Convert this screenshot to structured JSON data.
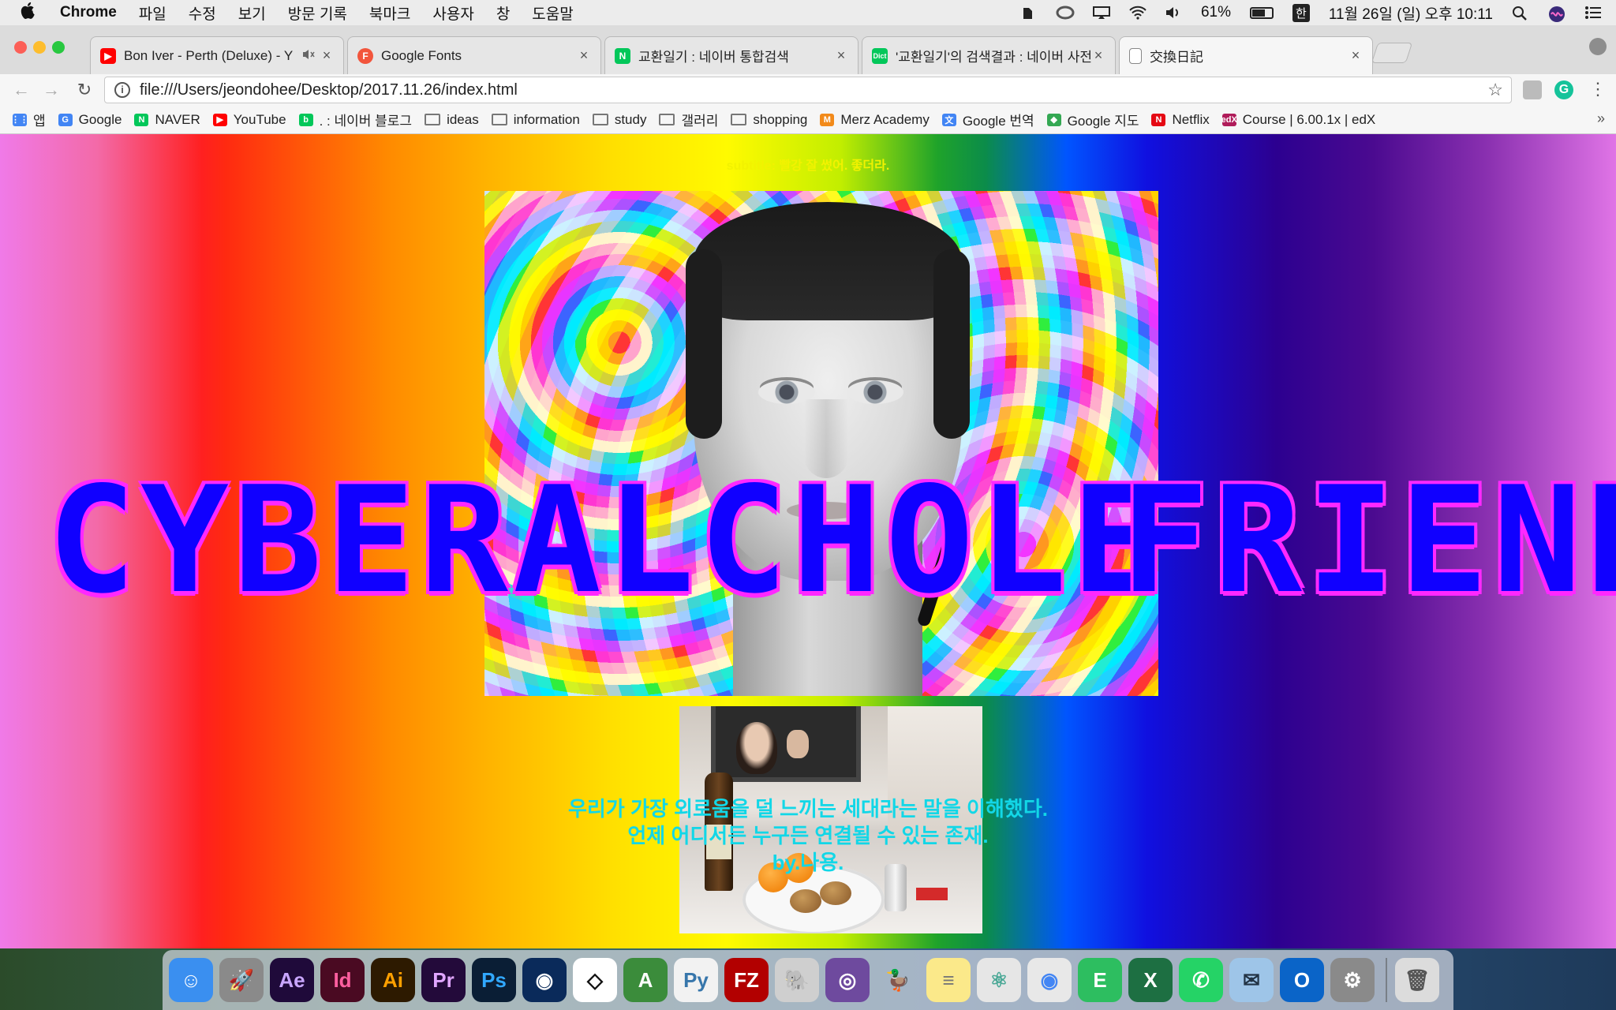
{
  "menubar": {
    "apple": "",
    "app_name": "Chrome",
    "menus": [
      "파일",
      "수정",
      "보기",
      "방문 기록",
      "북마크",
      "사용자",
      "창",
      "도움말"
    ],
    "battery": "61%",
    "battery_level": 0.61,
    "ime": "한",
    "clock": "11월 26일 (일) 오후 10:11"
  },
  "tabs": [
    {
      "title": "Bon Iver - Perth (Deluxe) - Y",
      "favicon_color": "#ff0000",
      "favicon_glyph": "▶",
      "muted_icon": "speaker-muted-icon",
      "close": "×"
    },
    {
      "title": "Google Fonts",
      "favicon_color": "#f2553c",
      "favicon_glyph": "F",
      "close": "×"
    },
    {
      "title": "교환일기 : 네이버 통합검색",
      "favicon_color": "#03c75a",
      "favicon_glyph": "N",
      "close": "×"
    },
    {
      "title": "'교환일기'의 검색결과 : 네이버 사전",
      "favicon_color": "#03c75a",
      "favicon_glyph": "Dict",
      "close": "×"
    },
    {
      "title": "交換日記",
      "favicon_color": "#ffffff",
      "favicon_glyph": "",
      "close": "×"
    }
  ],
  "toolbar": {
    "back": "←",
    "forward": "→",
    "reload": "↻",
    "info": "i",
    "url": "file:///Users/jeondohee/Desktop/2017.11.26/index.html",
    "star": "☆",
    "grammarly": "G",
    "menu": "⋮"
  },
  "bookmarks": [
    {
      "label": "앱",
      "icon": "apps-grid-icon",
      "color": "#4285f4",
      "glyph": "⋮⋮"
    },
    {
      "label": "Google",
      "icon": "google-icon",
      "color": "#4285f4",
      "glyph": "G"
    },
    {
      "label": "NAVER",
      "icon": "naver-icon",
      "color": "#03c75a",
      "glyph": "N"
    },
    {
      "label": "YouTube",
      "icon": "youtube-icon",
      "color": "#ff0000",
      "glyph": "▶"
    },
    {
      "label": ". : 네이버 블로그",
      "icon": "naver-blog-icon",
      "color": "#03c75a",
      "glyph": "b"
    },
    {
      "label": "ideas",
      "icon": "folder-icon",
      "folder": true
    },
    {
      "label": "information",
      "icon": "folder-icon",
      "folder": true
    },
    {
      "label": "study",
      "icon": "folder-icon",
      "folder": true
    },
    {
      "label": "갤러리",
      "icon": "folder-icon",
      "folder": true
    },
    {
      "label": "shopping",
      "icon": "folder-icon",
      "folder": true
    },
    {
      "label": "Merz Academy",
      "icon": "merz-icon",
      "color": "#f28a1a",
      "glyph": "M"
    },
    {
      "label": "Google 번역",
      "icon": "google-translate-icon",
      "color": "#4285f4",
      "glyph": "文"
    },
    {
      "label": "Google 지도",
      "icon": "google-maps-icon",
      "color": "#34a853",
      "glyph": "◆"
    },
    {
      "label": "Netflix",
      "icon": "netflix-icon",
      "color": "#e50914",
      "glyph": "N"
    },
    {
      "label": "Course | 6.00.1x | edX",
      "icon": "edx-icon",
      "color": "#b01c5a",
      "glyph": "edX"
    }
  ],
  "bookmarks_more": "»",
  "page": {
    "subtitle": "subtitle: 빨강 잘 썼어. 좋더라.",
    "title_words": [
      "CYBER",
      "ALCHOLE",
      "FRIEND"
    ],
    "caption_lines": [
      "우리가 가장 외로움을 덜 느끼는 세대라는 말을 이해했다.",
      "언제 어디서든 누구든 연결될 수 있는 존재.",
      "by.나용."
    ]
  },
  "dock": [
    {
      "name": "finder-icon",
      "bg": "#3a8ff0",
      "glyph": "☺"
    },
    {
      "name": "launchpad-icon",
      "bg": "#8a8a8a",
      "glyph": "🚀"
    },
    {
      "name": "after-effects-icon",
      "bg": "#1f0a3a",
      "glyph": "Ae",
      "fg": "#c9a6ff"
    },
    {
      "name": "indesign-icon",
      "bg": "#4a0a22",
      "glyph": "Id",
      "fg": "#ff5fa0"
    },
    {
      "name": "illustrator-icon",
      "bg": "#2d1a00",
      "glyph": "Ai",
      "fg": "#ffa000"
    },
    {
      "name": "premiere-icon",
      "bg": "#230a3a",
      "glyph": "Pr",
      "fg": "#e0a6ff"
    },
    {
      "name": "photoshop-icon",
      "bg": "#0a1e35",
      "glyph": "Ps",
      "fg": "#31a8ff"
    },
    {
      "name": "cinema4d-icon",
      "bg": "#0a2a5a",
      "glyph": "◉"
    },
    {
      "name": "unity-icon",
      "bg": "#ffffff",
      "glyph": "◇",
      "fg": "#111"
    },
    {
      "name": "android-studio-icon",
      "bg": "#3b8c3b",
      "glyph": "A"
    },
    {
      "name": "python-icon",
      "bg": "#f2f2f2",
      "glyph": "Py",
      "fg": "#3776ab"
    },
    {
      "name": "filezilla-icon",
      "bg": "#b20000",
      "glyph": "FZ"
    },
    {
      "name": "sequel-pro-icon",
      "bg": "#cfcfcf",
      "glyph": "🐘",
      "fg": "#333"
    },
    {
      "name": "github-icon",
      "bg": "#6e4a9e",
      "glyph": "◎"
    },
    {
      "name": "cyberduck-icon",
      "bg": "transparent",
      "glyph": "🦆",
      "fg": "#f2c200"
    },
    {
      "name": "notes-icon",
      "bg": "#fbe98a",
      "glyph": "≡",
      "fg": "#777"
    },
    {
      "name": "atom-icon",
      "bg": "#e6e6e6",
      "glyph": "⚛",
      "fg": "#4aa896"
    },
    {
      "name": "chrome-icon",
      "bg": "#e8e8e8",
      "glyph": "◉",
      "fg": "#4285f4"
    },
    {
      "name": "evernote-icon",
      "bg": "#2dbe60",
      "glyph": "E"
    },
    {
      "name": "excel-icon",
      "bg": "#1d6f42",
      "glyph": "X"
    },
    {
      "name": "whatsapp-icon",
      "bg": "#25d366",
      "glyph": "✆"
    },
    {
      "name": "mail-icon",
      "bg": "#9ec5e8",
      "glyph": "✉",
      "fg": "#234"
    },
    {
      "name": "outlook-icon",
      "bg": "#0a64c8",
      "glyph": "O"
    },
    {
      "name": "system-preferences-icon",
      "bg": "#8a8a8a",
      "glyph": "⚙"
    },
    {
      "name": "trash-icon",
      "bg": "#dcdcdc",
      "glyph": "🗑",
      "fg": "#555",
      "after_separator": true
    }
  ]
}
